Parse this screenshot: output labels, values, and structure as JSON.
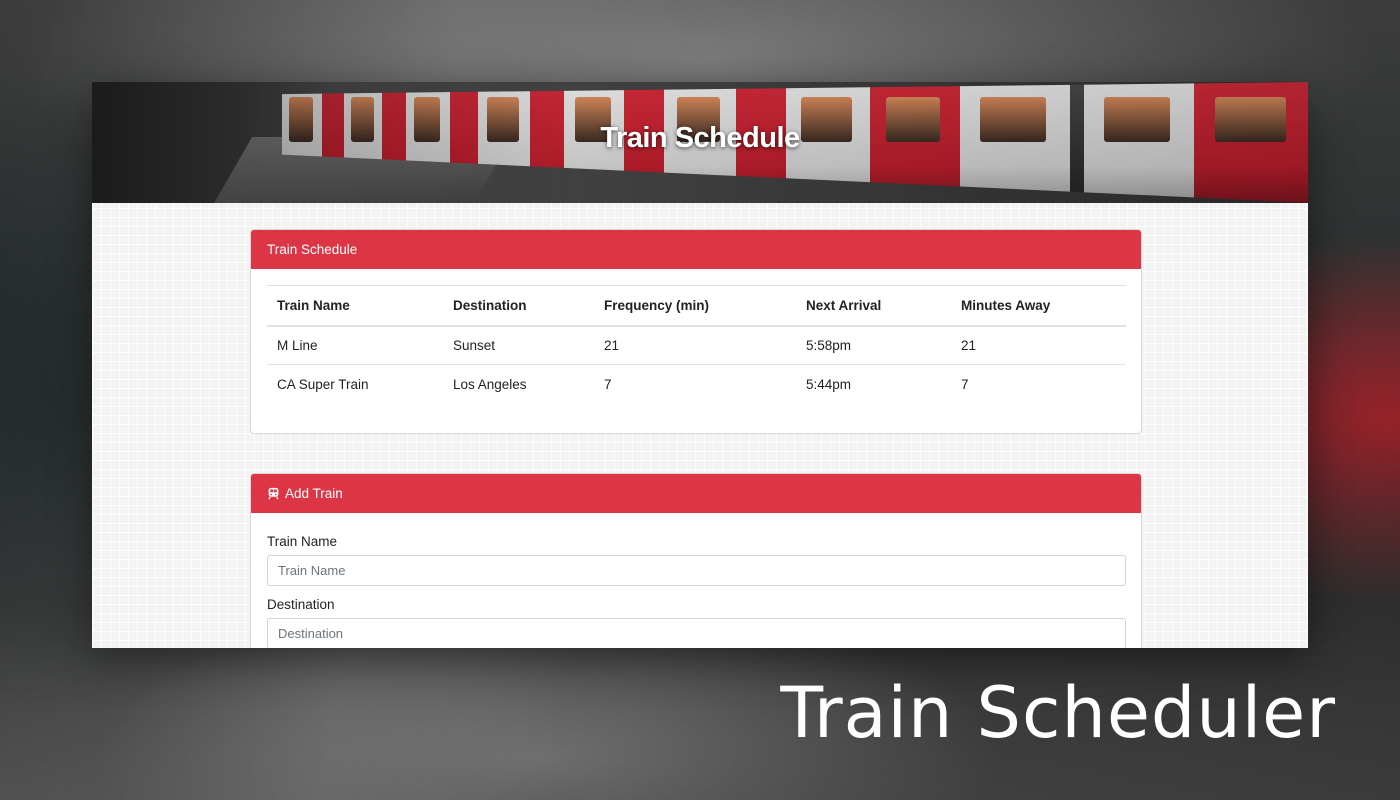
{
  "hero": {
    "title": "Train Schedule"
  },
  "schedule": {
    "header": "Train Schedule",
    "columns": [
      "Train Name",
      "Destination",
      "Frequency (min)",
      "Next Arrival",
      "Minutes Away"
    ],
    "rows": [
      [
        "M Line",
        "Sunset",
        "21",
        "5:58pm",
        "21"
      ],
      [
        "CA Super Train",
        "Los Angeles",
        "7",
        "5:44pm",
        "7"
      ]
    ]
  },
  "add_train": {
    "header": "Add Train",
    "icon": "train-icon",
    "fields": [
      {
        "label": "Train Name",
        "placeholder": "Train Name",
        "value": ""
      },
      {
        "label": "Destination",
        "placeholder": "Destination",
        "value": ""
      }
    ]
  },
  "caption": "Train Scheduler",
  "colors": {
    "accent": "#dc3545",
    "text": "#222222"
  }
}
